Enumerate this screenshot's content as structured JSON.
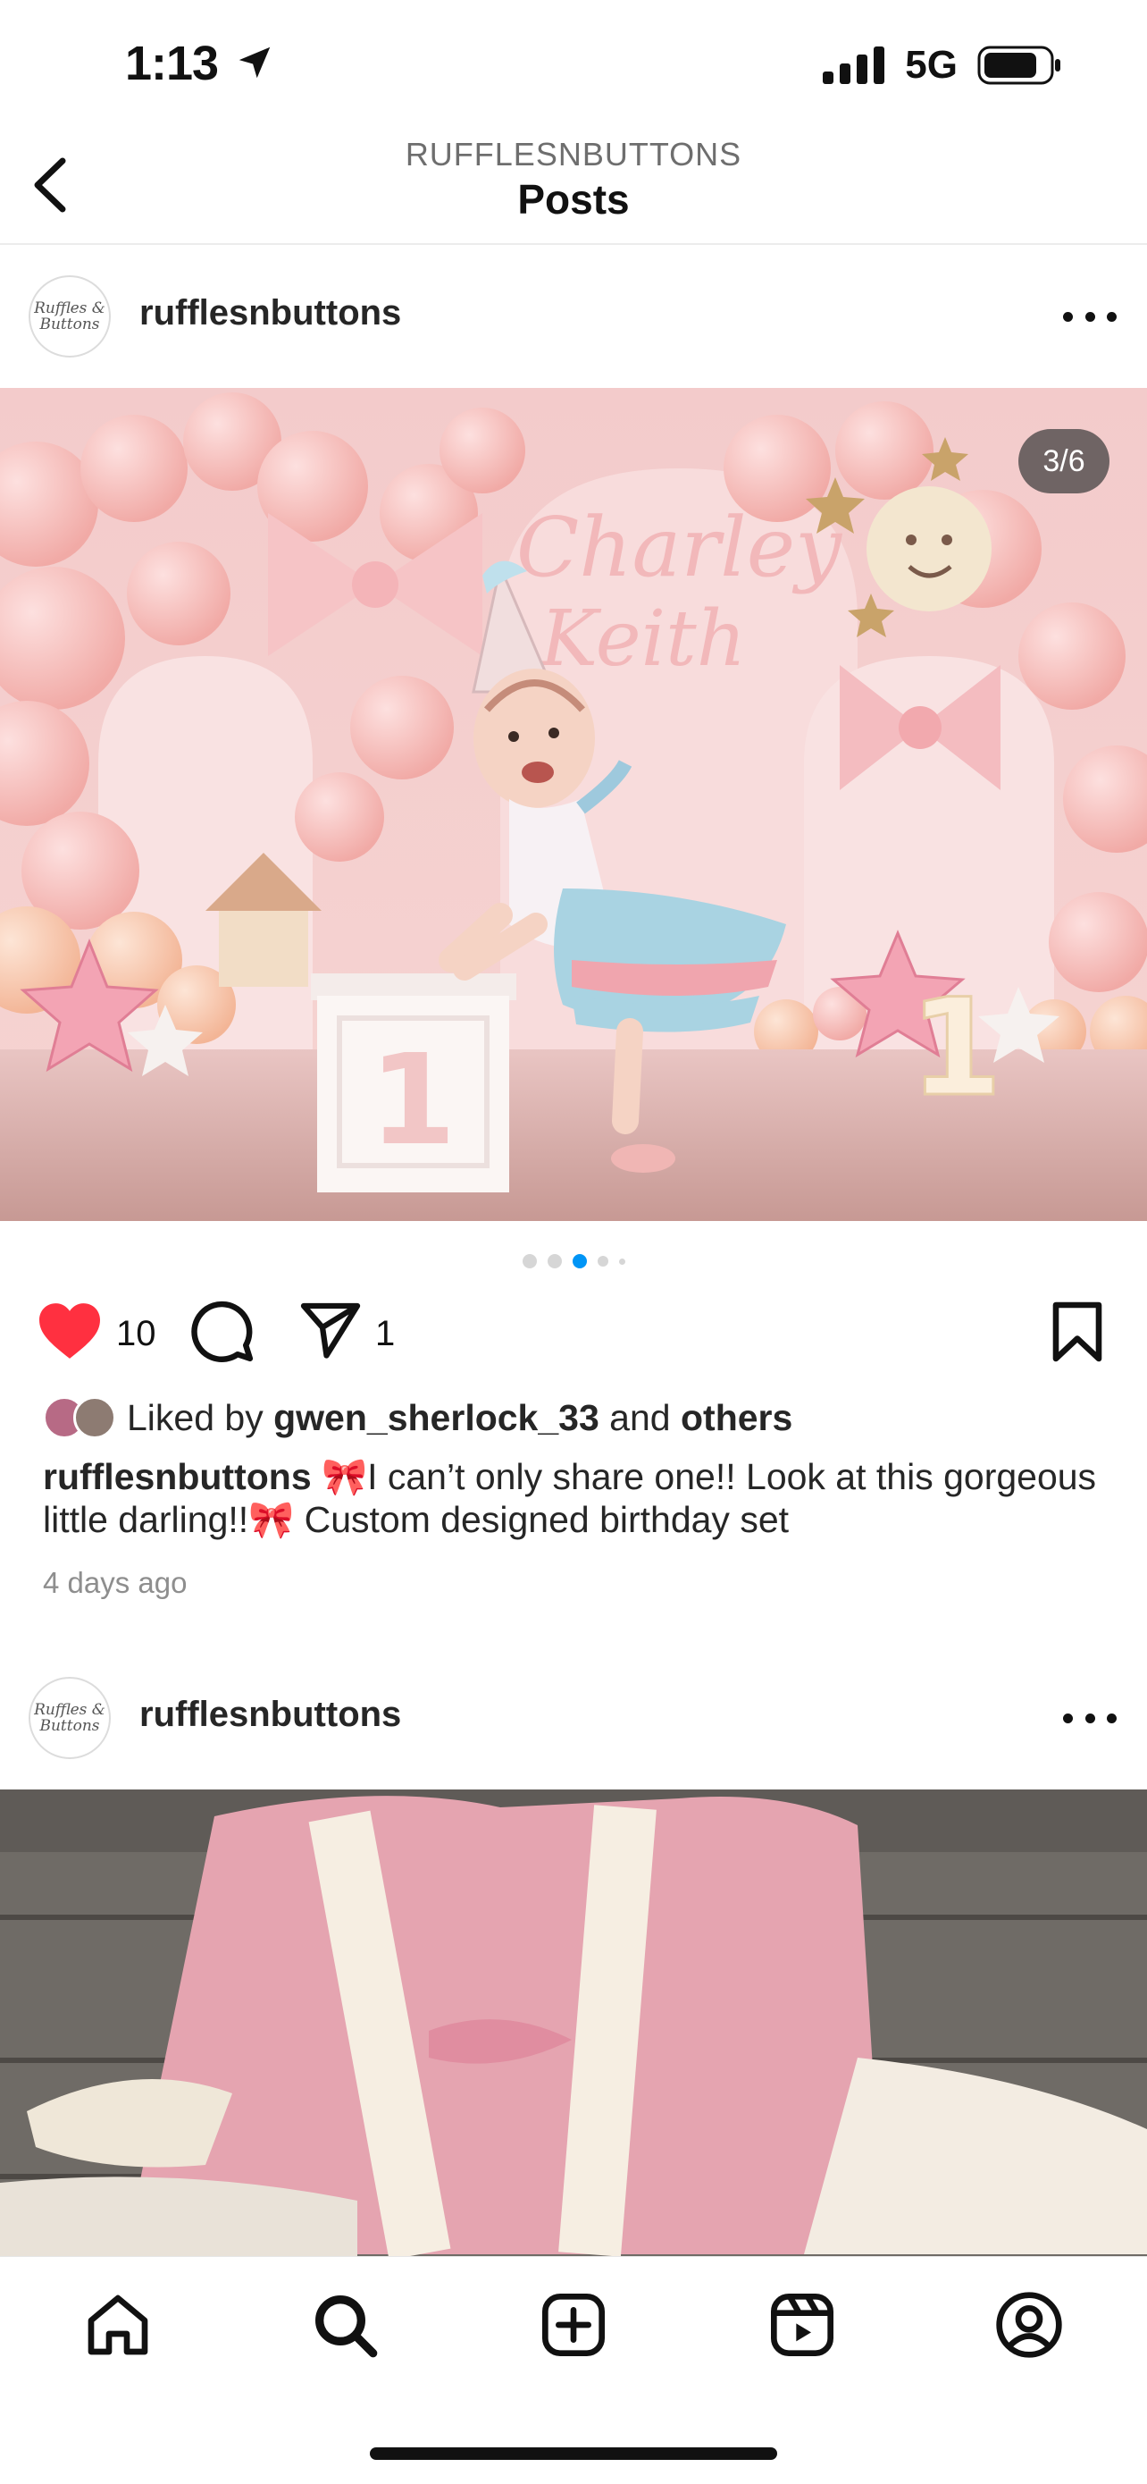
{
  "status_bar": {
    "time": "1:13",
    "network": "5G"
  },
  "header": {
    "account": "RUFFLESNBUTTONS",
    "title": "Posts"
  },
  "posts": [
    {
      "username": "rufflesnbuttons",
      "avatar_text": "Ruffles & Buttons",
      "photo_counter": "3/6",
      "carousel": {
        "active_index": 2,
        "visible_dots": 5
      },
      "likes_count": "10",
      "shares_count": "1",
      "liked_by_prefix": "Liked by",
      "liked_by_user": "gwen_sherlock_33",
      "liked_by_and": "and",
      "liked_by_others": "others",
      "caption_user": "rufflesnbuttons",
      "caption_text": "🎀I can’t only share one!! Look at this gorgeous little darling!!🎀 Custom designed  birthday set",
      "time_ago": "4 days ago",
      "photo_text": {
        "name_line1": "Charley",
        "name_line2": "Keith",
        "cube_number": "1",
        "marquee_number": "1"
      }
    },
    {
      "username": "rufflesnbuttons",
      "avatar_text": "Ruffles & Buttons"
    }
  ],
  "icons": {
    "back": "chevron-left-icon",
    "location": "location-arrow-icon",
    "signal": "signal-bars-icon",
    "battery": "battery-icon",
    "more": "more-horizontal-icon",
    "like": "heart-filled-icon",
    "comment": "comment-bubble-icon",
    "share": "paper-plane-icon",
    "save": "bookmark-icon",
    "tabs": [
      "home-icon",
      "search-icon",
      "create-icon",
      "reels-icon",
      "profile-icon"
    ]
  },
  "colors": {
    "like_red": "#ff3040",
    "carousel_active": "#0095f6",
    "muted_text": "#8e8e8e"
  }
}
